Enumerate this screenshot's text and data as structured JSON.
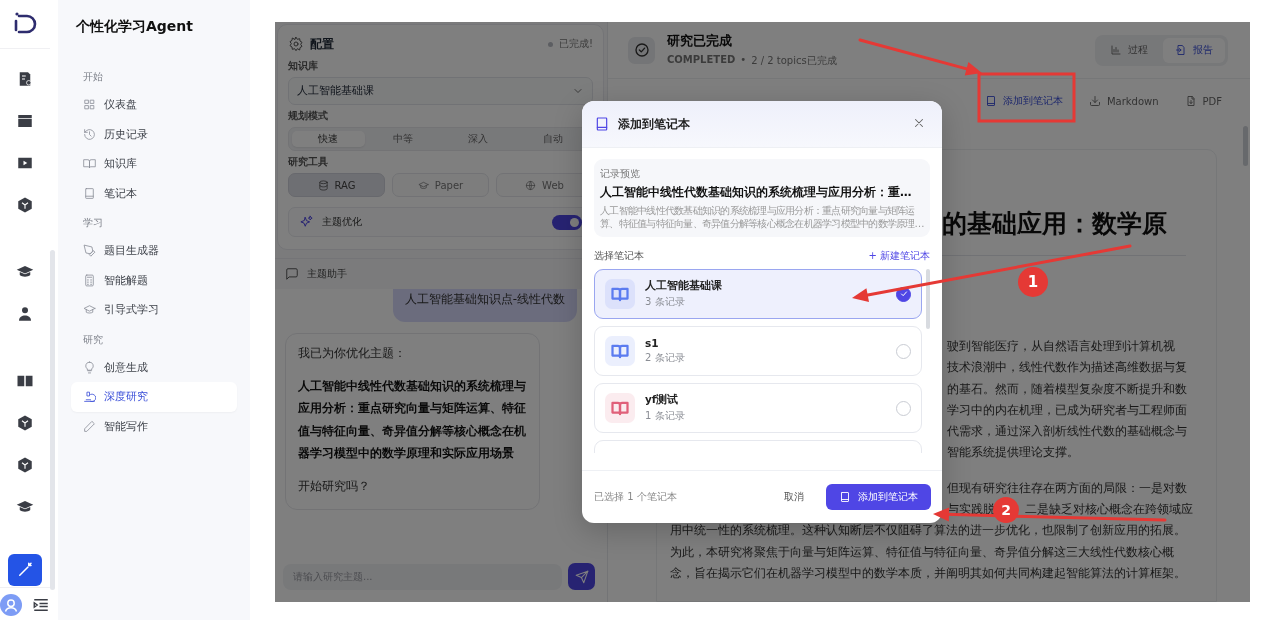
{
  "app": {
    "title": "个性化学习Agent"
  },
  "nav": [
    {
      "heading": "开始",
      "items": [
        {
          "label": "仪表盘",
          "selected": false
        },
        {
          "label": "历史记录",
          "selected": false
        },
        {
          "label": "知识库",
          "selected": false
        },
        {
          "label": "笔记本",
          "selected": false
        }
      ]
    },
    {
      "heading": "学习",
      "items": [
        {
          "label": "题目生成器",
          "selected": false
        },
        {
          "label": "智能解题",
          "selected": false
        },
        {
          "label": "引导式学习",
          "selected": false
        }
      ]
    },
    {
      "heading": "研究",
      "items": [
        {
          "label": "创意生成",
          "selected": false
        },
        {
          "label": "深度研究",
          "selected": true
        },
        {
          "label": "智能写作",
          "selected": false
        }
      ]
    }
  ],
  "config": {
    "title": "配置",
    "status": "已完成!",
    "knowledge_base": {
      "label": "知识库",
      "value": "人工智能基础课"
    },
    "plan_mode": {
      "label": "规划模式",
      "options": [
        {
          "label": "快速",
          "selected": true
        },
        {
          "label": "中等",
          "selected": false
        },
        {
          "label": "深入",
          "selected": false
        },
        {
          "label": "自动",
          "selected": false
        }
      ]
    },
    "tools": {
      "label": "研究工具",
      "options": [
        {
          "label": "RAG",
          "selected": true
        },
        {
          "label": "Paper",
          "selected": false
        },
        {
          "label": "Web",
          "selected": false
        }
      ]
    },
    "topic_optimize": {
      "label": "主题优化",
      "on": true
    }
  },
  "assistant": {
    "title": "主题助手",
    "user_message": "人工智能基础知识点-线性代数",
    "reply": [
      {
        "text": "我已为你优化主题：",
        "bold": false
      },
      {
        "text": "人工智能中线性代数基础知识的系统梳理与应用分析：重点研究向量与矩阵运算、特征值与特征向量、奇异值分解等核心概念在机器学习模型中的数学原理和实际应用场景",
        "bold": true
      },
      {
        "text": "开始研究吗？",
        "bold": false
      }
    ],
    "input": {
      "placeholder": "请输入研究主题..."
    }
  },
  "report": {
    "title": "研究已完成",
    "status": "COMPLETED",
    "separator": "•",
    "progress": "2 / 2 topics已完成",
    "tabs": [
      {
        "label": "过程",
        "selected": false
      },
      {
        "label": "报告",
        "selected": true
      }
    ],
    "actions": [
      "添加到笔记本",
      "Markdown",
      "PDF"
    ],
    "heading": "的基础应用：数学原",
    "lines": [
      {
        "kind": "clipped",
        "text": "驶到智能医疗，从自然语言处理到计算机视"
      },
      {
        "kind": "clipped",
        "text": "技术浪潮中，线性代数作为描述高维数据与复"
      },
      {
        "kind": "clipped",
        "text": "的基石。然而，随着模型复杂度不断提升和数"
      },
      {
        "kind": "clipped",
        "text": "学习中的内在机理，已成为研究者与工程师面"
      },
      {
        "kind": "clipped",
        "text": "代需求，通过深入剖析线性代数的基础概念与"
      },
      {
        "kind": "clipped",
        "text": "智能系统提供理论支撑。"
      },
      {
        "kind": "break"
      },
      {
        "kind": "clipped",
        "text": "但现有研究往往存在两方面的局限：一是对数"
      },
      {
        "kind": "clipped",
        "text": "与实践脱",
        "tail": "二是缺乏对核心概念在跨领域应"
      },
      {
        "kind": "full",
        "text": "用中统一性的系统梳理。这种认知断层不仅阻碍了算法的进一步优化，也限制了创新应用的拓展。"
      },
      {
        "kind": "full",
        "text": "为此，本研究将聚焦于向量与矩阵运算、特征值与特征向量、奇异值分解这三大线性代数核心概"
      },
      {
        "kind": "full",
        "text": "念，旨在揭示它们在机器学习模型中的数学本质，并阐明其如何共同构建起智能算法的计算框架。"
      }
    ]
  },
  "dialog": {
    "title": "添加到笔记本",
    "preview_label": "记录预览",
    "preview_title": "人工智能中线性代数基础知识的系统梳理与应用分析：重…",
    "preview_text": "人工智能中线性代数基础知识的系统梳理与应用分析：重点研究向量与矩阵运算、特征值与特征向量、奇异值分解等核心概念在机器学习模型中的数学原理…",
    "select_label": "选择笔记本",
    "new_notebook": "+ 新建笔记本",
    "notebooks": [
      {
        "name": "人工智能基础课",
        "count": "3 条记录",
        "selected": true,
        "color": "#5b7bf0"
      },
      {
        "name": "s1",
        "count": "2 条记录",
        "selected": false,
        "color": "#5b7bf0"
      },
      {
        "name": "yf测试",
        "count": "1 条记录",
        "selected": false,
        "color": "#e0607a"
      }
    ],
    "selection_summary": "已选择 1 个笔记本",
    "cancel": "取消",
    "confirm": "添加到笔记本"
  },
  "annotations": [
    {
      "label": "1"
    },
    {
      "label": "2"
    }
  ]
}
